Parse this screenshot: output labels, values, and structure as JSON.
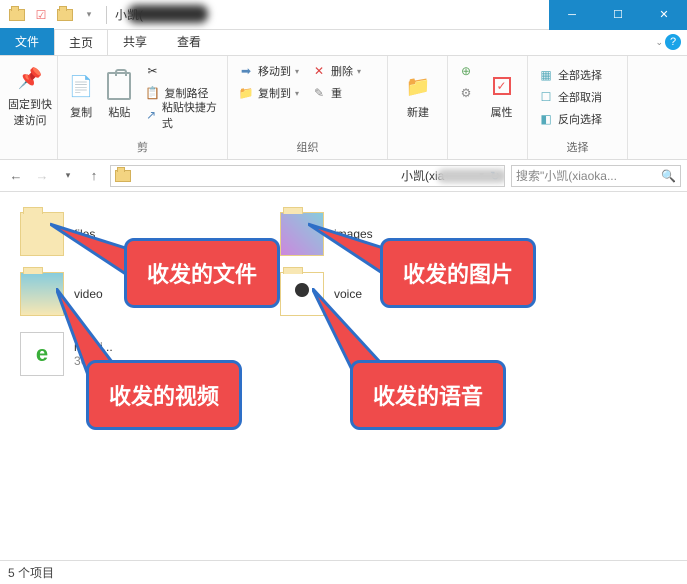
{
  "title": "小凯(",
  "tabs": {
    "file": "文件",
    "home": "主页",
    "share": "共享",
    "view": "查看"
  },
  "ribbon": {
    "pin": "固定到快\n速访问",
    "copy": "复制",
    "paste": "粘贴",
    "cut": "剪",
    "copypath": "复制路径",
    "pasteshortcut": "粘贴快捷方式",
    "moveto": "移动到",
    "delete": "删除",
    "copyto": "复制到",
    "rename": "重",
    "new": "新建",
    "properties": "属性",
    "selectall": "全部选择",
    "selectnone": "全部取消",
    "invertsel": "反向选择",
    "g_clipboard": "剪",
    "g_organize": "组织",
    "g_select": "选择"
  },
  "address": {
    "crumbs": "小凯(xia",
    "search": "搜索\"小凯(xiaoka..."
  },
  "items": {
    "files": "files",
    "images": "images",
    "video": "video",
    "voice": "voice",
    "msg": "msg.i...",
    "msgsize": "36"
  },
  "callouts": {
    "files": "收发的文件",
    "images": "收发的图片",
    "video": "收发的视频",
    "voice": "收发的语音"
  },
  "status": "5 个项目"
}
